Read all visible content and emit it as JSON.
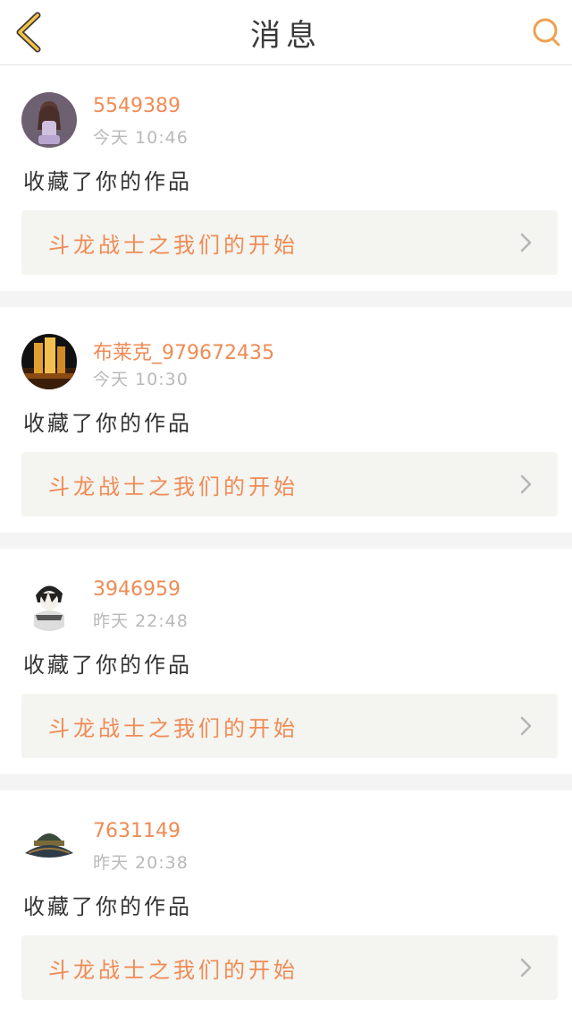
{
  "header": {
    "title": "消息",
    "back_icon": "chevron-left-icon",
    "search_icon": "search-icon",
    "accent_color": "#f0a050"
  },
  "messages": [
    {
      "user": "5549389",
      "time": "今天 10:46",
      "action": "收藏了你的作品",
      "work_title": "斗龙战士之我们的开始",
      "avatar": "girl-avatar"
    },
    {
      "user": "布莱克_979672435",
      "time": "今天 10:30",
      "action": "收藏了你的作品",
      "work_title": "斗龙战士之我们的开始",
      "avatar": "city-night-avatar"
    },
    {
      "user": "3946959",
      "time": "昨天 22:48",
      "action": "收藏了你的作品",
      "work_title": "斗龙战士之我们的开始",
      "avatar": "anime-boy-avatar"
    },
    {
      "user": "7631149",
      "time": "昨天 20:38",
      "action": "收藏了你的作品",
      "work_title": "斗龙战士之我们的开始",
      "avatar": "hat-avatar"
    }
  ]
}
